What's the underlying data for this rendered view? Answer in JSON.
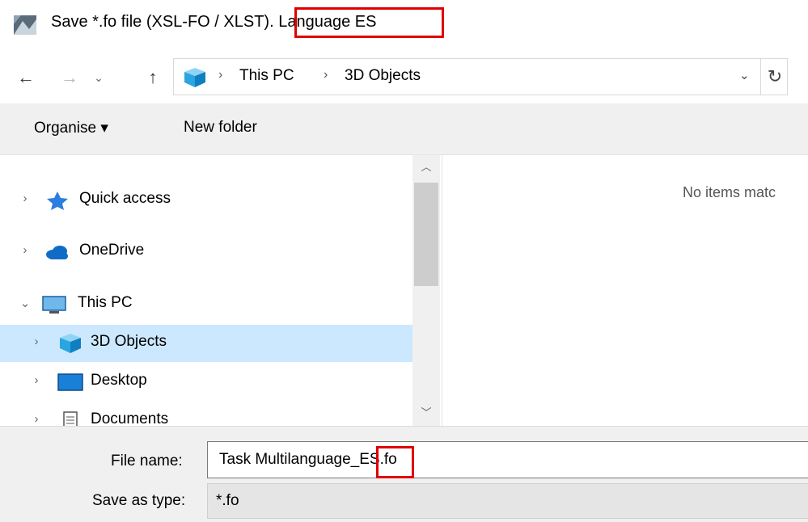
{
  "window": {
    "title": "Save *.fo file (XSL-FO / XLST). Language ES",
    "title_icon": "save-dialog-app-icon"
  },
  "navigation": {
    "back_icon": "back-arrow-icon",
    "forward_icon": "forward-arrow-icon",
    "recent_icon": "chevron-down-icon",
    "up_icon": "up-arrow-icon",
    "breadcrumb": [
      "This PC",
      "3D Objects"
    ],
    "refresh_icon": "refresh-icon"
  },
  "toolbar": {
    "organise_label": "Organise ▾",
    "new_folder_label": "New folder"
  },
  "nav_tree": [
    {
      "label": "Quick access",
      "icon": "star-icon",
      "expanded": false
    },
    {
      "label": "OneDrive",
      "icon": "cloud-icon",
      "expanded": false
    },
    {
      "label": "This PC",
      "icon": "computer-icon",
      "expanded": true
    },
    {
      "label": "3D Objects",
      "icon": "cube-icon",
      "expanded": false,
      "selected": true
    },
    {
      "label": "Desktop",
      "icon": "desktop-icon",
      "expanded": false
    },
    {
      "label": "Documents",
      "icon": "documents-icon",
      "expanded": false
    }
  ],
  "content": {
    "empty_message": "No items matc"
  },
  "form": {
    "file_name_label": "File name:",
    "file_name_value": "Task Multilanguage_ES.fo",
    "save_type_label": "Save as type:",
    "save_type_value": "*.fo"
  },
  "colors": {
    "highlight_border": "#e00000",
    "selection": "#cce8ff",
    "toolbar_bg": "#f0f0f0"
  }
}
